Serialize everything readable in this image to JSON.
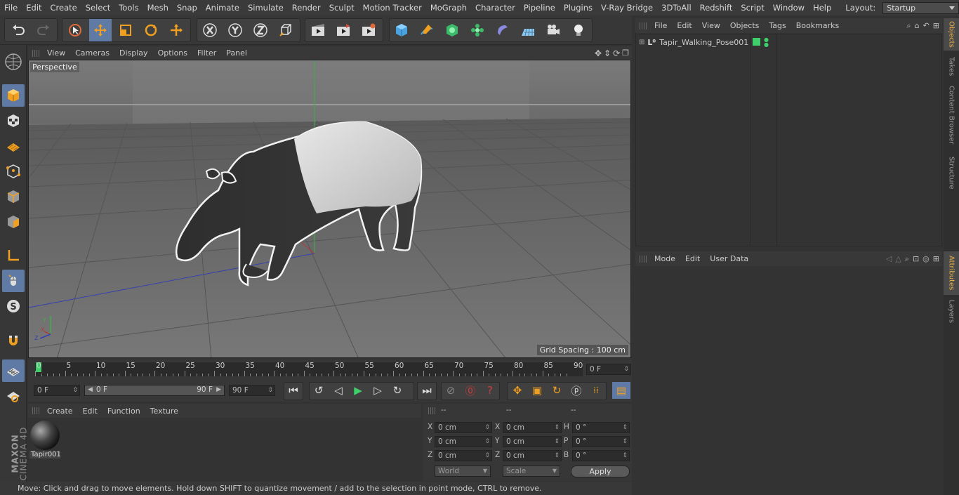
{
  "menubar": {
    "items": [
      "File",
      "Edit",
      "Create",
      "Select",
      "Tools",
      "Mesh",
      "Snap",
      "Animate",
      "Simulate",
      "Render",
      "Sculpt",
      "Motion Tracker",
      "MoGraph",
      "Character",
      "Pipeline",
      "Plugins",
      "V-Ray Bridge",
      "3DToAll",
      "Redshift",
      "Script",
      "Window",
      "Help"
    ],
    "layout_label": "Layout:",
    "layout_value": "Startup"
  },
  "viewport": {
    "menu": [
      "View",
      "Cameras",
      "Display",
      "Options",
      "Filter",
      "Panel"
    ],
    "label": "Perspective",
    "grid_spacing": "Grid Spacing : 100 cm",
    "axis_x": "X",
    "axis_y": "Y",
    "axis_z": "Z"
  },
  "timeline": {
    "ticks": [
      "0",
      "5",
      "10",
      "15",
      "20",
      "25",
      "30",
      "35",
      "40",
      "45",
      "50",
      "55",
      "60",
      "65",
      "70",
      "75",
      "80",
      "85",
      "90"
    ],
    "current_frame": "0 F"
  },
  "playbar": {
    "start": "0 F",
    "range_start": "0 F",
    "range_end": "90 F",
    "end": "90 F"
  },
  "material": {
    "menu": [
      "Create",
      "Edit",
      "Function",
      "Texture"
    ],
    "name": "Tapir001"
  },
  "coords": {
    "headers": [
      "--",
      "--",
      "--"
    ],
    "rows": [
      {
        "a": "X",
        "av": "0 cm",
        "b": "X",
        "bv": "0 cm",
        "c": "H",
        "cv": "0 °"
      },
      {
        "a": "Y",
        "av": "0 cm",
        "b": "Y",
        "bv": "0 cm",
        "c": "P",
        "cv": "0 °"
      },
      {
        "a": "Z",
        "av": "0 cm",
        "b": "Z",
        "bv": "0 cm",
        "c": "B",
        "cv": "0 °"
      }
    ],
    "world": "World",
    "scale": "Scale",
    "apply": "Apply"
  },
  "objects": {
    "menu": [
      "File",
      "Edit",
      "View",
      "Objects",
      "Tags",
      "Bookmarks"
    ],
    "item": "Tapir_Walking_Pose001"
  },
  "attributes": {
    "menu": [
      "Mode",
      "Edit",
      "User Data"
    ]
  },
  "right_tabs": [
    "Objects",
    "Takes",
    "Content Browser",
    "Structure",
    "Attributes",
    "Layers"
  ],
  "brand": {
    "line1": "MAXON",
    "line2": "CINEMA 4D"
  },
  "status": "Move: Click and drag to move elements. Hold down SHIFT to quantize movement / add to the selection in point mode, CTRL to remove.",
  "colors": {
    "accent": "#5e7aa5",
    "active_tab": "#e8b04a",
    "play": "#3ecf6a",
    "record": "#d23b3b"
  }
}
